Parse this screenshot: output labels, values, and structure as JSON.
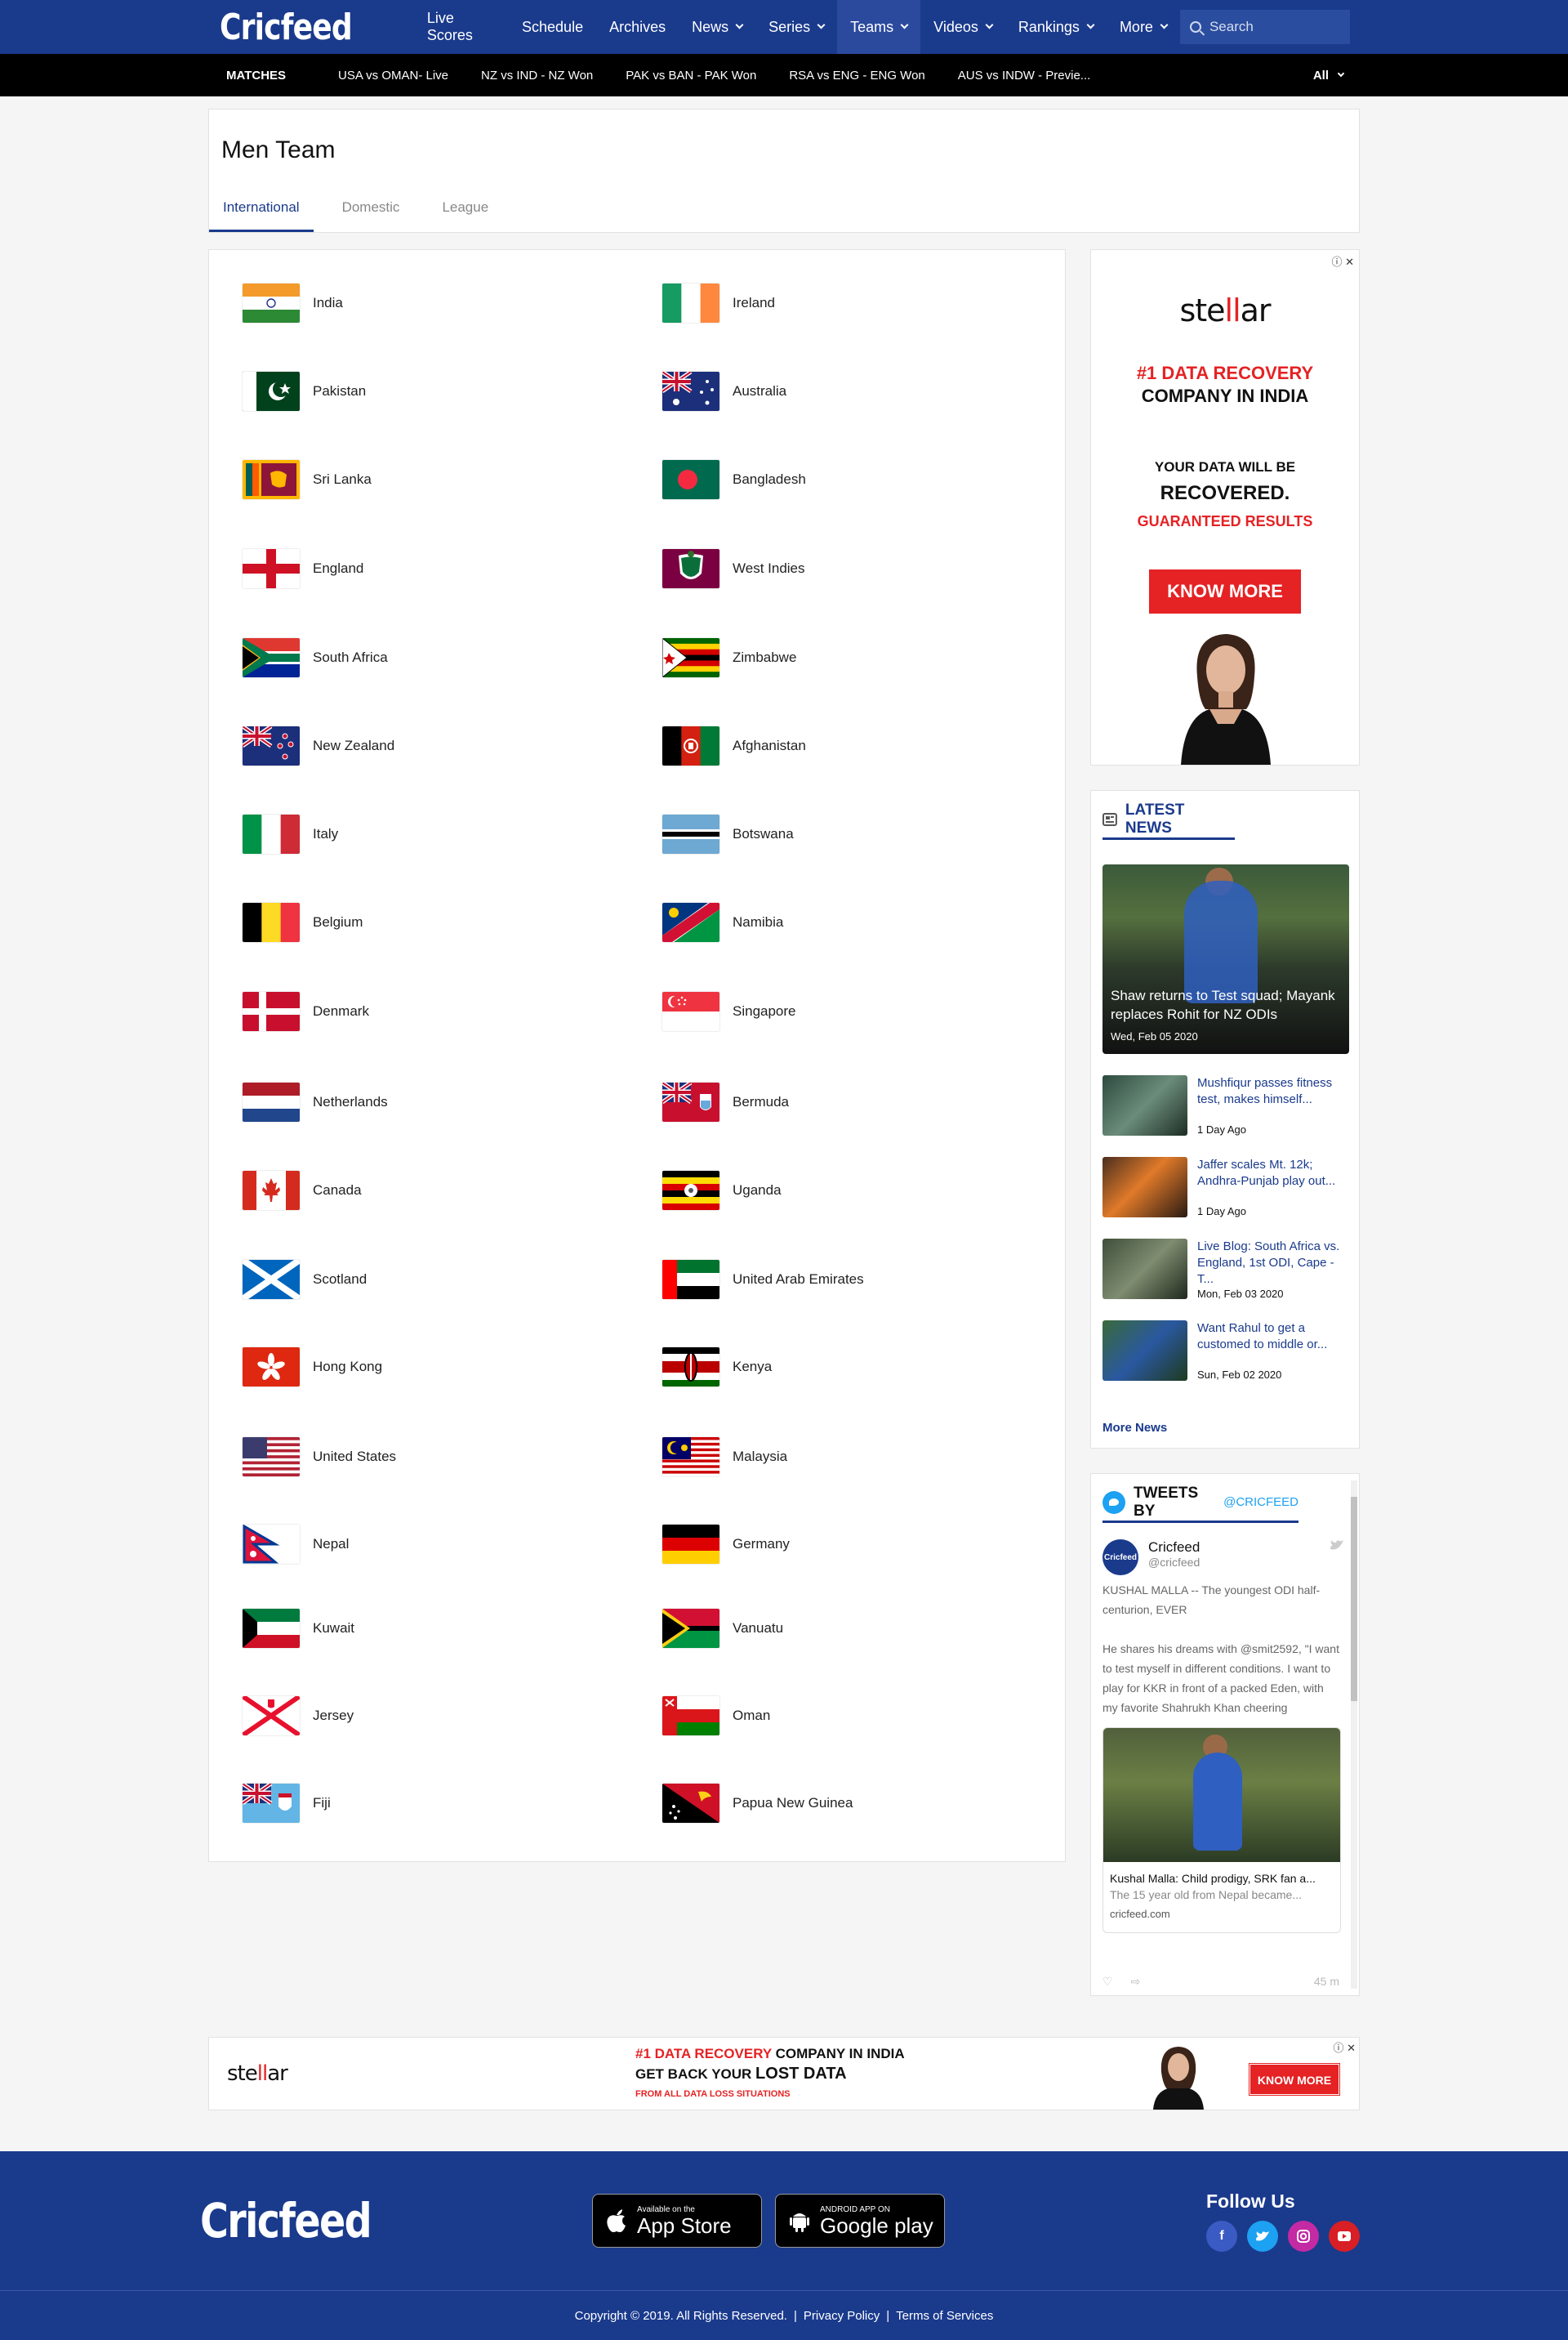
{
  "nav": {
    "logo": "Cricfeed",
    "links": [
      {
        "label": "Live Scores",
        "dropdown": false
      },
      {
        "label": "Schedule",
        "dropdown": false
      },
      {
        "label": "Archives",
        "dropdown": false
      },
      {
        "label": "News",
        "dropdown": true
      },
      {
        "label": "Series",
        "dropdown": true
      },
      {
        "label": "Teams",
        "dropdown": true
      },
      {
        "label": "Videos",
        "dropdown": true
      },
      {
        "label": "Rankings",
        "dropdown": true
      },
      {
        "label": "More",
        "dropdown": true
      }
    ],
    "search_placeholder": "Search"
  },
  "matches": {
    "title": "MATCHES",
    "items": [
      "USA vs OMAN- Live",
      "NZ vs IND - NZ Won",
      "PAK vs BAN - PAK Won",
      "RSA vs  ENG - ENG Won",
      "AUS vs INDW - Previe..."
    ],
    "filter": "All"
  },
  "page": {
    "title": "Men Team",
    "tabs": [
      "International",
      "Domestic",
      "League"
    ]
  },
  "teams": {
    "left": [
      "India",
      "Pakistan",
      "Sri Lanka",
      "England",
      "South Africa",
      "New Zealand",
      "Italy",
      "Belgium",
      "Denmark",
      "Netherlands",
      "Canada",
      "Scotland",
      "Hong Kong",
      "United States",
      "Nepal",
      "Kuwait",
      "Jersey",
      "Fiji"
    ],
    "right": [
      "Ireland",
      "Australia",
      "Bangladesh",
      "West Indies",
      "Zimbabwe",
      "Afghanistan",
      "Botswana",
      "Namibia",
      "Singapore",
      "Bermuda",
      "Uganda",
      "United Arab Emirates",
      "Kenya",
      "Malaysia",
      "Germany",
      "Vanuatu",
      "Oman",
      "Papua New Guinea"
    ]
  },
  "side_ad": {
    "brand": "stellar",
    "line1": "#1 DATA RECOVERY",
    "line2": "COMPANY IN INDIA",
    "line3": "YOUR DATA WILL BE",
    "line4": "RECOVERED.",
    "line5": "GUARANTEED RESULTS",
    "button": "KNOW MORE"
  },
  "latest_news": {
    "title": "LATEST NEWS",
    "featured": {
      "title": "Shaw returns to Test squad; Mayank replaces Rohit for NZ ODIs",
      "date": "Wed, Feb 05 2020"
    },
    "items": [
      {
        "title": "Mushfiqur passes fitness test, makes himself...",
        "date": "1 Day Ago"
      },
      {
        "title": "Jaffer scales Mt. 12k; Andhra-Punjab play out...",
        "date": "1 Day Ago"
      },
      {
        "title": "Live Blog: South Africa vs. England, 1st ODI, Cape - T...",
        "date": "Mon, Feb 03 2020"
      },
      {
        "title": "Want Rahul to get a customed to middle or...",
        "date": "Sun, Feb 02 2020"
      }
    ],
    "more": "More News"
  },
  "tweets": {
    "title": "TWEETS BY",
    "handle_title": "@CRICFEED",
    "user": "Cricfeed",
    "handle": "@cricfeed",
    "avatar_text": "Cricfeed",
    "text1": "KUSHAL MALLA -- The youngest ODI half-centurion, EVER",
    "text2": "He shares his dreams with @smit2592, \"I want to test myself in different conditions. I want to play for KKR in front of a packed Eden, with my favorite Shahrukh Khan cheering",
    "card_title": "Kushal Malla: Child prodigy, SRK fan a...",
    "card_sub": "The 15 year old from Nepal became...",
    "card_url": "cricfeed.com",
    "time": "45 m"
  },
  "bottom_ad": {
    "brand": "stellar",
    "l1_red": "#1 DATA RECOVERY",
    "l1_black": " COMPANY IN INDIA",
    "l2_a": "GET BACK YOUR ",
    "l2_b": "LOST DATA",
    "l3": "FROM ALL DATA LOSS SITUATIONS",
    "button": "KNOW MORE"
  },
  "footer": {
    "logo": "Cricfeed",
    "appstore_small": "Available on the",
    "appstore_big": "App Store",
    "play_small": "ANDROID APP ON",
    "play_big": "Google play",
    "follow": "Follow Us",
    "copyright": "Copyright © 2019. All Rights Reserved.",
    "privacy": "Privacy Policy",
    "terms": "Terms of Services",
    "sep": "|"
  },
  "colors": {
    "brand": "#1a3a8c",
    "accent_red": "#e52224",
    "twitter": "#1da1f2"
  }
}
